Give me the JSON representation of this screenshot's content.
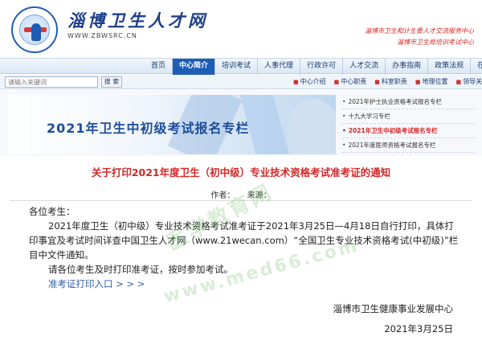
{
  "header": {
    "site_title": "淄博卫生人才网",
    "site_url": "WWW.ZBWSRC.CN",
    "right_lines": [
      "淄博市卫生和计生委人才交流服务中心",
      "淄博市卫生局培训考试中心"
    ]
  },
  "nav": {
    "items": [
      {
        "label": "首页"
      },
      {
        "label": "中心简介"
      },
      {
        "label": "培训考试"
      },
      {
        "label": "人事代理"
      },
      {
        "label": "行政许可"
      },
      {
        "label": "人才交流"
      },
      {
        "label": "办事指南"
      },
      {
        "label": "政策法规"
      },
      {
        "label": "在线服务"
      }
    ],
    "active_index": 1
  },
  "search": {
    "placeholder": "请输入关键词",
    "button_label": "搜 索"
  },
  "subnav": {
    "items": [
      {
        "label": "中心介绍"
      },
      {
        "label": "中心职责"
      },
      {
        "label": "科室职责"
      },
      {
        "label": "地理位置"
      },
      {
        "label": "领导关怀"
      }
    ]
  },
  "banner": {
    "title": "2021年卫生中初级考试报名专栏"
  },
  "side_list": {
    "items": [
      {
        "label": "2021年护士执业资格考试报名专栏"
      },
      {
        "label": "十九大学习专栏"
      },
      {
        "label": "2021年卫生中初级考试报名专栏"
      },
      {
        "label": "2021年度医师资格考试报名专栏"
      }
    ],
    "active_index": 2
  },
  "article": {
    "title": "关于打印2021年度卫生（初中级）专业技术资格考试准考证的通知",
    "author_label": "作者：",
    "source_label": "来源：",
    "greeting": "各位考生：",
    "para1": "2021年度卫生（初中级）专业技术资格考试准考证于2021年3月25日—4月18日自行打印，具体打印事宜及考试时间详查中国卫生人才网（www.21wecan.com）“全国卫生专业技术资格考试(中初级)”栏目中文件通知。",
    "para2": "请各位考生及时打印准考证，按时参加考试。",
    "link": "准考证打印入口 > > >",
    "signature": "淄博市卫生健康事业发展中心",
    "date": "2021年3月25日"
  },
  "watermarks": [
    "医学教育网",
    "www.med66.com"
  ]
}
